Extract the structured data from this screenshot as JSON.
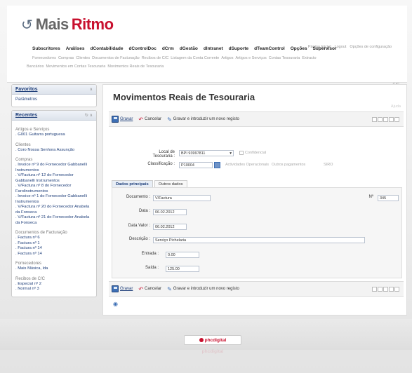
{
  "logo": {
    "part1": "Mais",
    "part2": "Ritmo"
  },
  "toplinks": [
    "Página Inicial",
    "Logout",
    "Opções de configuração"
  ],
  "mainnav": [
    "Subscritores",
    "Análises",
    "dContabilidade",
    "dControlDoc",
    "dCrm",
    "dGestão",
    "dIntranet",
    "dSuporte",
    "dTeamControl",
    "Opções",
    "Supervisor"
  ],
  "subnav": [
    "Fornecedores",
    "Compras",
    "Clientes",
    "Documentos de Facturação",
    "Recibos de C/C",
    "Listagem da Conta Corrente",
    "Artigos",
    "Artigos e Serviços",
    "Contas Tesouraria",
    "Extracto"
  ],
  "subnav2": [
    "Bancários",
    "Movimentos em Contas Tesouraria",
    "Movimentos Reais de Tesouraria"
  ],
  "cic": "CIC",
  "sidebar": {
    "favoritos": {
      "title": "Favoritos",
      "items": [
        "Parâmetros"
      ]
    },
    "recentes": {
      "title": "Recentes",
      "groups": [
        {
          "title": "Artigos e Serviços",
          "items": [
            ". G001 Guitarra portuguesa"
          ]
        },
        {
          "title": "Clientes",
          "items": [
            ". Coro Nossa Senhora Assunção"
          ]
        },
        {
          "title": "Compras",
          "items": [
            ". Invoice nº 9 do Fornecedor Gabbanelli Instrumentos",
            ". V/Factura nº 12 do Fornecedor Gabbanelli Instrumentos",
            ". V/Factura nº 8 do Fornecedor Farolinstrumentos",
            ". Invoice nº 1 do Fornecedor Gabbanelli Instrumentos",
            ". V/Factura nº 20 do Fornecedor Anabela da Fonseca",
            ". V/Factura nº 21 do Fornecedor Anabela da Fonseca"
          ]
        },
        {
          "title": "Documentos de Facturação",
          "items": [
            ". Factura nº 6",
            ". Factura nº 1",
            ". Factura nº 14",
            ". Factura nº 14"
          ]
        },
        {
          "title": "Fornecedores",
          "items": [
            ". Mais Música, lda"
          ]
        },
        {
          "title": "Recibos de C/C",
          "items": [
            ". Especial nº 2",
            ". Normal nº 3"
          ]
        }
      ]
    }
  },
  "content": {
    "title": "Movimentos Reais de Tesouraria",
    "tag": "Ajuda",
    "toolbar": {
      "save": "Gravar",
      "cancel": "Cancelar",
      "save_new": "Gravar e introduzir um novo registo"
    },
    "local_label": "Local de Tesouraria :",
    "local_value": "BPI 93997811",
    "confidencial": "Confidencial",
    "class_label": "Classificação :",
    "class_value": "P10004",
    "class_opts": [
      "Actividades Operacionais",
      "Outros pagamentos",
      "SIRO"
    ],
    "tabs": [
      "Dados principais",
      "Outros dados"
    ],
    "form": {
      "documento_label": "Documento :",
      "documento_value": "V/Factura",
      "n_label": "Nº",
      "n_value": "345",
      "data_label": "Data :",
      "data_value": "06.02.2012",
      "datavalor_label": "Data Valor :",
      "datavalor_value": "06.02.2012",
      "descricao_label": "Descrição :",
      "descricao_value": "Serviço Pichelaria",
      "entrada_label": "Entrada :",
      "entrada_value": "0.00",
      "saida_label": "Saída :",
      "saida_value": "125.00"
    }
  },
  "brand": "phcdigital"
}
